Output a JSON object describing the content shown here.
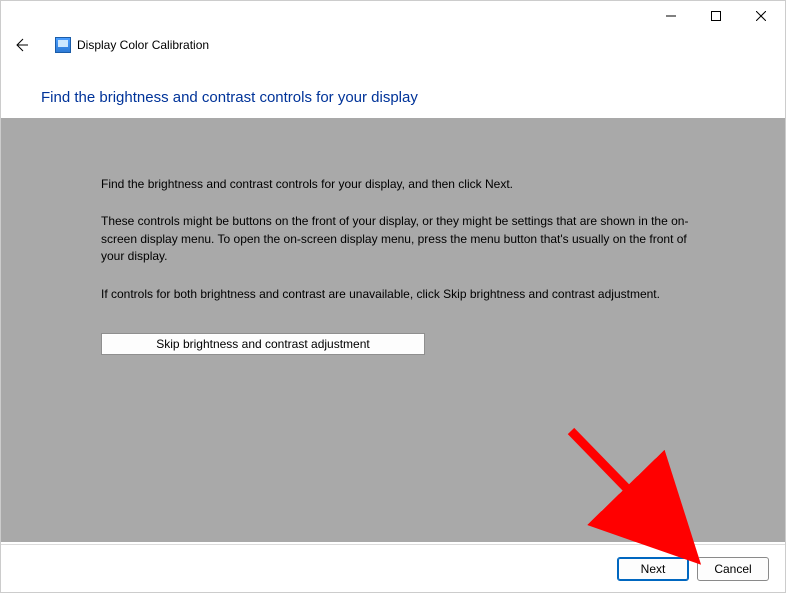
{
  "window": {
    "title": "Display Color Calibration"
  },
  "heading": "Find the brightness and contrast controls for your display",
  "body": {
    "p1": "Find the brightness and contrast controls for your display, and then click Next.",
    "p2": "These controls might be buttons on the front of your display, or they might be settings that are shown in the on-screen display menu. To open the on-screen display menu, press the menu button that's usually on the front of your display.",
    "p3": "If controls for both brightness and contrast are unavailable, click Skip brightness and contrast adjustment."
  },
  "buttons": {
    "skip": "Skip brightness and contrast adjustment",
    "next": "Next",
    "cancel": "Cancel"
  }
}
